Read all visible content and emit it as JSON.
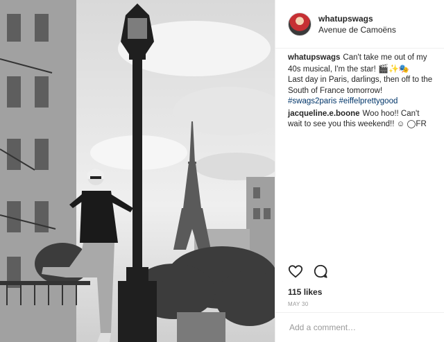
{
  "post": {
    "username": "whatupswags",
    "location": "Avenue de Camoëns",
    "caption": {
      "user": "whatupswags",
      "line1": "Can't take me out of my 40s musical, I'm the star!",
      "emojis": "🎬✨🎭",
      "line2": "Last day in Paris, darlings, then off to the South of France tomorrow!",
      "hashtags": [
        "#swags2paris",
        "#eiffelprettygood"
      ]
    },
    "comment": {
      "user": "jacqueline.e.boone",
      "text": "Woo hoo!! Can't wait to see you this weekend!!",
      "suffix": "☺ ◯FR"
    },
    "likes": "115 likes",
    "date": "MAY 30",
    "add_comment_placeholder": "Add a comment…"
  },
  "icons": {
    "like": "heart-icon",
    "comment": "speech-bubble-icon"
  },
  "colors": {
    "link": "#003569",
    "text": "#262626",
    "muted": "#999999"
  }
}
